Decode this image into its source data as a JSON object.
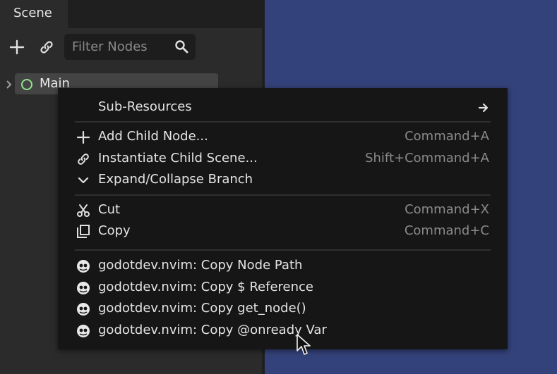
{
  "scene_panel": {
    "tab_label": "Scene",
    "toolbar": {
      "add_icon": "plus-icon",
      "link_icon": "link-icon",
      "filter_placeholder": "Filter Nodes",
      "search_icon": "search-icon"
    },
    "tree": {
      "root_node": {
        "label": "Main",
        "icon": "node-circle-icon",
        "icon_color": "#8ee58a"
      }
    }
  },
  "viewport": {
    "background_color": "#33427a"
  },
  "context_menu": {
    "sub_resources": {
      "label": "Sub-Resources",
      "icon": "arrow-right-icon"
    },
    "group1": [
      {
        "label": "Add Child Node...",
        "shortcut": "Command+A",
        "icon": "plus-icon"
      },
      {
        "label": "Instantiate Child Scene...",
        "shortcut": "Shift+Command+A",
        "icon": "link-icon"
      },
      {
        "label": "Expand/Collapse Branch",
        "shortcut": "",
        "icon": "chevron-down-icon"
      }
    ],
    "group2": [
      {
        "label": "Cut",
        "shortcut": "Command+X",
        "icon": "scissors-icon"
      },
      {
        "label": "Copy",
        "shortcut": "Command+C",
        "icon": "copy-icon"
      }
    ],
    "group3": [
      {
        "label": "godotdev.nvim: Copy Node Path",
        "icon": "godot-icon"
      },
      {
        "label": "godotdev.nvim: Copy $ Reference",
        "icon": "godot-icon"
      },
      {
        "label": "godotdev.nvim: Copy get_node()",
        "icon": "godot-icon"
      },
      {
        "label": "godotdev.nvim: Copy @onready Var",
        "icon": "godot-icon"
      }
    ]
  }
}
